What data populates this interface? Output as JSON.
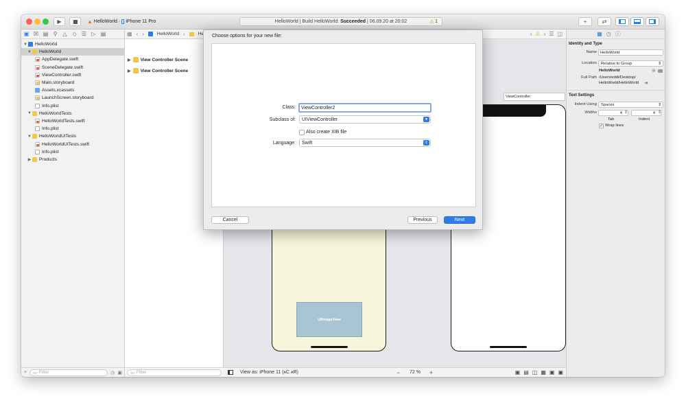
{
  "toolbar": {
    "scheme_project": "HelloWorld",
    "scheme_device": "iPhone 11 Pro",
    "activity_prefix": "HelloWorld | Build HelloWorld:",
    "activity_status": "Succeeded",
    "activity_time": "| 06.09.20 at 20:02",
    "warning_count": "1"
  },
  "navigator": {
    "items": [
      {
        "label": "HelloWorld",
        "icon": "project-icon"
      },
      {
        "label": "HelloWorld",
        "icon": "folder-icon"
      },
      {
        "label": "AppDelegate.swift",
        "icon": "swift-file-icon"
      },
      {
        "label": "SceneDelegate.swift",
        "icon": "swift-file-icon"
      },
      {
        "label": "ViewController.swift",
        "icon": "swift-file-icon"
      },
      {
        "label": "Main.storyboard",
        "icon": "storyboard-icon"
      },
      {
        "label": "Assets.xcassets",
        "icon": "assets-icon"
      },
      {
        "label": "LaunchScreen.storyboard",
        "icon": "storyboard-icon"
      },
      {
        "label": "Info.plist",
        "icon": "plist-icon"
      },
      {
        "label": "HelloWorldTests",
        "icon": "folder-icon"
      },
      {
        "label": "HelloWorldTests.swift",
        "icon": "swift-file-icon"
      },
      {
        "label": "Info.plist",
        "icon": "plist-icon"
      },
      {
        "label": "HelloWorldUITests",
        "icon": "folder-icon"
      },
      {
        "label": "HelloWorldUITests.swift",
        "icon": "swift-file-icon"
      },
      {
        "label": "Info.plist",
        "icon": "plist-icon"
      },
      {
        "label": "Products",
        "icon": "folder-icon"
      }
    ],
    "filter_placeholder": "Filter"
  },
  "outline": {
    "breadcrumb_project": "HelloWorld",
    "breadcrumb_next": "He",
    "scenes": [
      "View Controller Scene",
      "View Controller Scene"
    ],
    "filter_placeholder": "Filter"
  },
  "canvas": {
    "imageview_label": "UIImageView",
    "vc_label": "ViewController",
    "view_as": "View as: iPhone 11 (ᴀC ᴀR)",
    "zoom": "72 %"
  },
  "inspector": {
    "identity_title": "Identity and Type",
    "name_label": "Name",
    "name_value": "HelloWorld",
    "location_label": "Location",
    "location_value": "Relative to Group",
    "location_folder": "HelloWorld",
    "full_path_label": "Full Path",
    "full_path_line1": "/Users/eddi/Desktop/",
    "full_path_line2": "HelloWorld/HelloWorld",
    "text_settings_title": "Text Settings",
    "indent_label": "Indent Using",
    "indent_value": "Spaces",
    "widths_label": "Widths",
    "tab_value": "4",
    "indent_width_value": "4",
    "tab_label": "Tab",
    "indent_sub_label": "Indent",
    "wrap_label": "Wrap lines"
  },
  "sheet": {
    "title": "Choose options for your new file:",
    "class_label": "Class:",
    "class_value": "ViewController2",
    "subclass_label": "Subclass of:",
    "subclass_value": "UIViewController",
    "xib_label": "Also create XIB file",
    "language_label": "Language:",
    "language_value": "Swift",
    "cancel": "Cancel",
    "previous": "Previous",
    "next": "Next"
  },
  "colors": {
    "accent": "#2f7ce6",
    "imageview": "#a8c5d3",
    "scene_background": "#f7f6da"
  }
}
